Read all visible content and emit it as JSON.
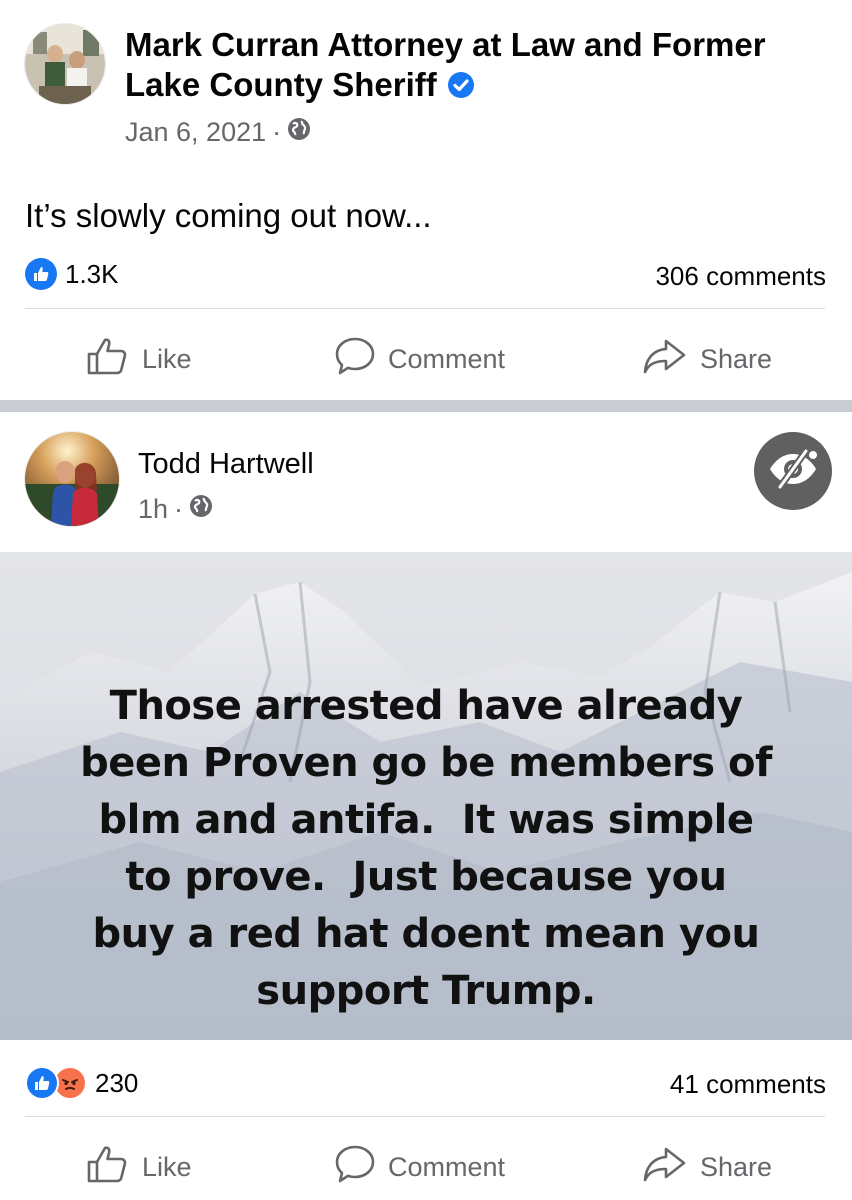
{
  "post1": {
    "author": "Mark Curran Attorney at Law and Former Lake County Sheriff",
    "author_line1": "Mark Curran Attorney at Law and Former",
    "author_line2": "Lake County Sheriff",
    "verified_icon": "verified-badge-icon",
    "date": "Jan 6, 2021",
    "separator": "·",
    "privacy_icon": "globe-icon",
    "text": "It’s slowly coming out now...",
    "reactions_count": "1.3K",
    "comments_count": "306 comments",
    "actions": {
      "like": "Like",
      "comment": "Comment",
      "share": "Share"
    }
  },
  "post2": {
    "author": "Todd Hartwell",
    "time": "1h",
    "separator": "·",
    "privacy_icon": "globe-icon",
    "hide_icon": "eye-slash-icon",
    "image_text_lines": [
      "Those arrested have already",
      "been Proven go be members of",
      "blm and antifa.  It was simple",
      "to prove.  Just because you",
      "buy a red hat doent mean you",
      "support Trump."
    ],
    "reactions_count": "230",
    "comments_count": "41 comments",
    "actions": {
      "like": "Like",
      "comment": "Comment",
      "share": "Share"
    }
  },
  "colors": {
    "facebook_blue": "#1877f2",
    "secondary_text": "#65676b",
    "divider": "#dadde1",
    "separator_band": "#c9ccd1",
    "angry_orange": "#f7714c"
  }
}
